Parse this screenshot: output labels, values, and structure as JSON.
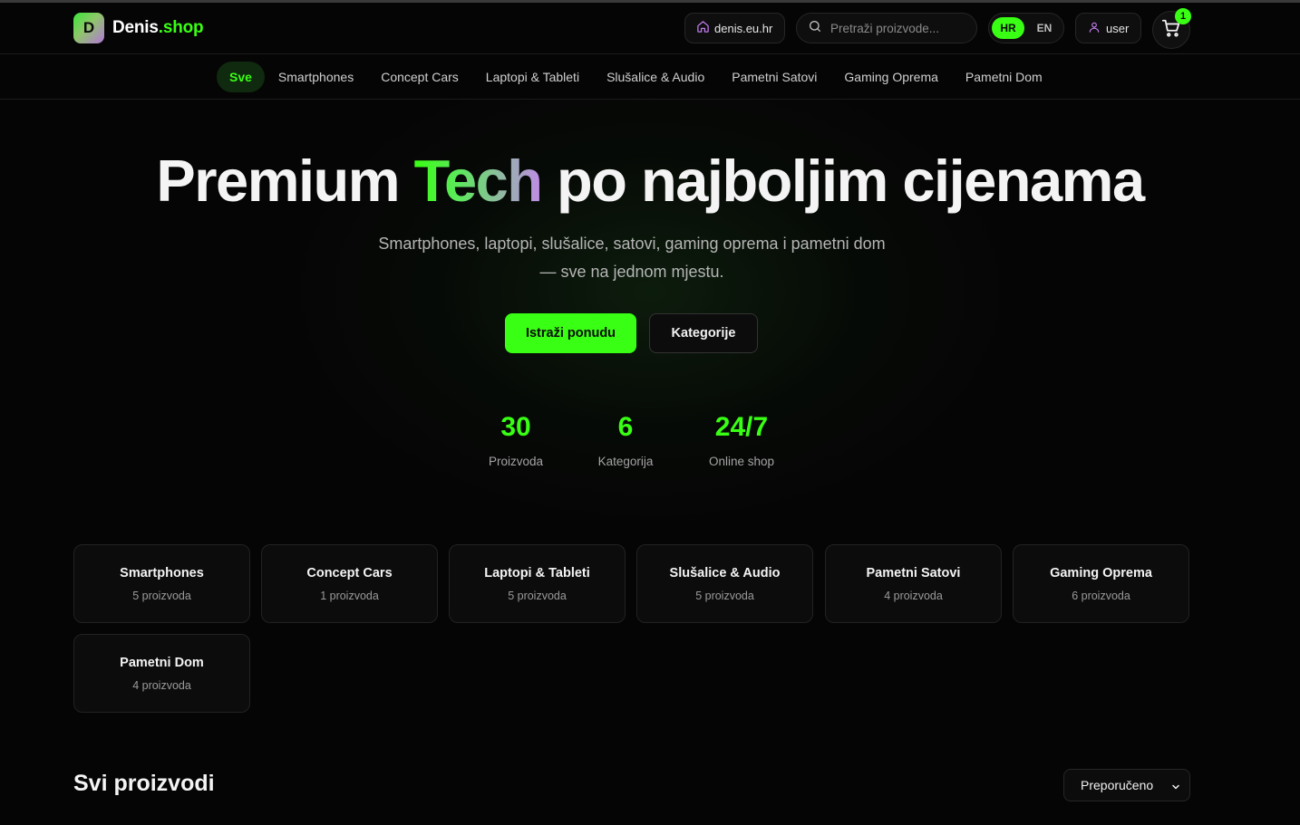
{
  "brand": {
    "logo_letter": "D",
    "name_main": "Denis",
    "name_accent": ".shop",
    "accent_color": "#39ff14"
  },
  "header": {
    "domain_label": "denis.eu.hr",
    "search_placeholder": "Pretraži proizvode...",
    "languages": [
      {
        "code": "HR",
        "active": true
      },
      {
        "code": "EN",
        "active": false
      }
    ],
    "user_label": "user",
    "cart_count": "1"
  },
  "nav": {
    "items": [
      {
        "label": "Sve",
        "active": true
      },
      {
        "label": "Smartphones"
      },
      {
        "label": "Concept Cars"
      },
      {
        "label": "Laptopi & Tableti"
      },
      {
        "label": "Slušalice & Audio"
      },
      {
        "label": "Pametni Satovi"
      },
      {
        "label": "Gaming Oprema"
      },
      {
        "label": "Pametni Dom"
      }
    ]
  },
  "hero": {
    "title_before": "Premium ",
    "title_highlight": "Tech",
    "title_after": " po najboljim cijenama",
    "subtitle_line1": "Smartphones, laptopi, slušalice, satovi, gaming oprema i pametni dom",
    "subtitle_line2": "— sve na jednom mjestu.",
    "primary_button": "Istraži ponudu",
    "secondary_button": "Kategorije"
  },
  "stats": [
    {
      "value": "30",
      "label": "Proizvoda"
    },
    {
      "value": "6",
      "label": "Kategorija"
    },
    {
      "value": "24/7",
      "label": "Online shop"
    }
  ],
  "categories": [
    {
      "title": "Smartphones",
      "count": "5 proizvoda"
    },
    {
      "title": "Concept Cars",
      "count": "1 proizvoda"
    },
    {
      "title": "Laptopi & Tableti",
      "count": "5 proizvoda"
    },
    {
      "title": "Slušalice & Audio",
      "count": "5 proizvoda"
    },
    {
      "title": "Pametni Satovi",
      "count": "4 proizvoda"
    },
    {
      "title": "Gaming Oprema",
      "count": "6 proizvoda"
    },
    {
      "title": "Pametni Dom",
      "count": "4 proizvoda"
    }
  ],
  "products_section": {
    "title": "Svi proizvodi",
    "sort_selected": "Preporučeno"
  }
}
